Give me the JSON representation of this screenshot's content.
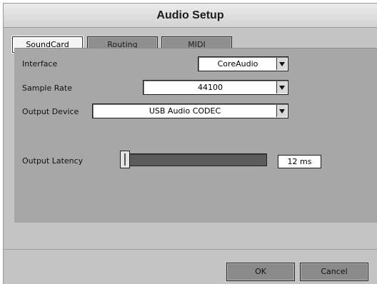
{
  "window": {
    "title": "Audio Setup"
  },
  "tabs": [
    {
      "label": "SoundCard",
      "active": true
    },
    {
      "label": "Routing",
      "active": false
    },
    {
      "label": "MIDI",
      "active": false
    }
  ],
  "fields": {
    "interface": {
      "label": "Interface",
      "value": "CoreAudio"
    },
    "sample_rate": {
      "label": "Sample Rate",
      "value": "44100"
    },
    "output_device": {
      "label": "Output Device",
      "value": "USB Audio CODEC"
    },
    "output_latency": {
      "label": "Output Latency",
      "value": "12 ms",
      "slider_level": 0.0
    }
  },
  "buttons": {
    "ok": "OK",
    "cancel": "Cancel"
  },
  "icons": {
    "dropdown_arrow": "chevron-down-icon"
  },
  "colors": {
    "panel": "#a7a7a7",
    "window": "#c4c4c4",
    "slider_track": "#5c5c5c"
  }
}
